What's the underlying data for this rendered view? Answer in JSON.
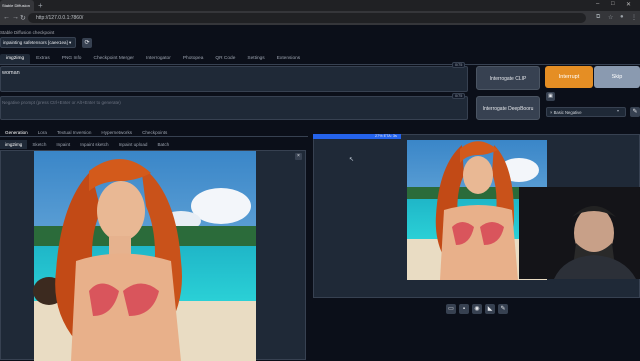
{
  "browser": {
    "tab_title": "Stable Diffusion",
    "newtab_icon": "+",
    "url": "http://127.0.0.1:7860/",
    "window_controls": [
      "–",
      "□",
      "✕"
    ]
  },
  "checkpoint": {
    "label": "Stable Diffusion checkpoint",
    "value": "inpainting safetensors [caee1ea]",
    "refresh_icon": "refresh-icon"
  },
  "main_tabs": [
    "img2img",
    "Extras",
    "PNG Info",
    "Checkpoint Merger",
    "Interrogator",
    "Photopea",
    "QR Code",
    "Settings",
    "Extensions"
  ],
  "active_main_tab": "img2img",
  "prompt": {
    "text": "woman",
    "counter": "0/75"
  },
  "negative_prompt": {
    "placeholder": "Negative prompt (press Ctrl+Enter or Alt+Enter to generate)",
    "counter": "0/75"
  },
  "buttons": {
    "interrogate_clip": "Interrogate CLIP",
    "interrogate_deepbooru": "Interrogate DeepBooru",
    "interrupt": "Interrupt",
    "skip": "Skip"
  },
  "styles": {
    "selected": "Basic Negative",
    "clear": "×"
  },
  "extra_tabs": [
    "Generation",
    "Lora",
    "Textual Inversion",
    "Hypernetworks",
    "Checkpoints"
  ],
  "mode_tabs": [
    "img2img",
    "Sketch",
    "Inpaint",
    "Inpaint sketch",
    "Inpaint upload",
    "Batch"
  ],
  "active_mode_tab": "img2img",
  "progress": {
    "text": "27% ETA: 3s",
    "fraction": 0.27
  },
  "output_tools": [
    "folder-icon",
    "save-icon",
    "zip-icon",
    "send-to-img2img-icon",
    "send-to-inpaint-icon"
  ],
  "colors": {
    "accent_orange": "#e58e24",
    "progress_blue": "#2563eb",
    "background": "#0b0f19"
  }
}
